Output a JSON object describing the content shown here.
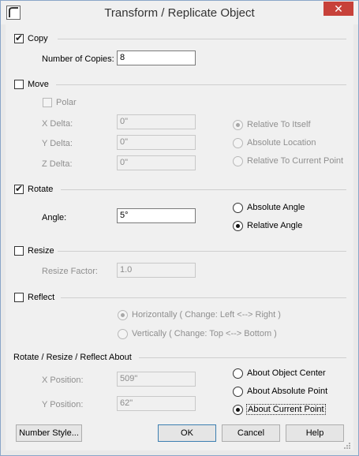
{
  "window": {
    "title": "Transform / Replicate Object",
    "close_glyph": "✕"
  },
  "copy": {
    "label": "Copy",
    "checked": true,
    "copies_label": "Number of Copies:",
    "copies_value": "8"
  },
  "move": {
    "label": "Move",
    "checked": false,
    "polar_label": "Polar",
    "x_label": "X Delta:",
    "x_value": "0\"",
    "y_label": "Y Delta:",
    "y_value": "0\"",
    "z_label": "Z Delta:",
    "z_value": "0\"",
    "opt_itself": "Relative To Itself",
    "opt_absolute": "Absolute Location",
    "opt_current": "Relative To Current Point"
  },
  "rotate": {
    "label": "Rotate",
    "checked": true,
    "angle_label": "Angle:",
    "angle_value": "5°",
    "opt_absolute": "Absolute Angle",
    "opt_relative": "Relative Angle"
  },
  "resize": {
    "label": "Resize",
    "checked": false,
    "factor_label": "Resize Factor:",
    "factor_value": "1.0"
  },
  "reflect": {
    "label": "Reflect",
    "checked": false,
    "opt_horizontal": "Horizontally ( Change: Left <--> Right )",
    "opt_vertical": "Vertically ( Change: Top <--> Bottom )"
  },
  "about": {
    "heading": "Rotate / Resize / Reflect About",
    "x_label": "X Position:",
    "x_value": "509\"",
    "y_label": "Y Position:",
    "y_value": "62\"",
    "opt_center": "About Object Center",
    "opt_absolute": "About Absolute Point",
    "opt_current": "About Current Point"
  },
  "buttons": {
    "number_style": "Number Style...",
    "ok": "OK",
    "cancel": "Cancel",
    "help": "Help"
  }
}
